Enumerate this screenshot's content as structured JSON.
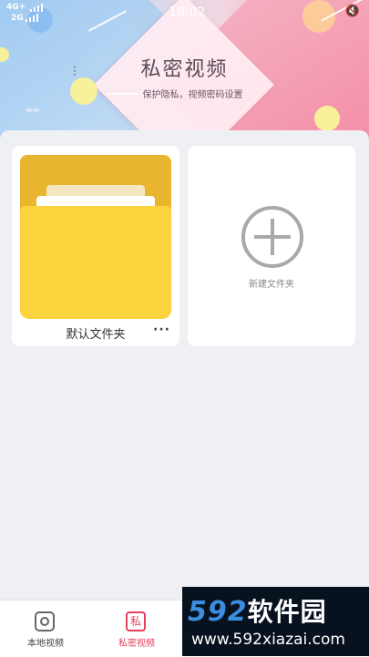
{
  "status_bar": {
    "network_top": "4G+",
    "network_bottom": "2G",
    "time": "18:02"
  },
  "header": {
    "title": "私密视频",
    "subtitle": "保护隐私，视频密码设置"
  },
  "folders": [
    {
      "label": "默认文件夹",
      "more_icon": "more-dots-icon"
    }
  ],
  "new_folder": {
    "label": "新建文件夹",
    "icon": "plus-circle-icon"
  },
  "tabbar": {
    "items": [
      {
        "label": "本地视频",
        "icon": "camera-icon",
        "active": false
      },
      {
        "label": "私密视频",
        "icon": "private-icon",
        "icon_text": "私",
        "active": true
      }
    ]
  },
  "watermark": {
    "logo_num": "592",
    "logo_text": "软件园",
    "url": "www.592xiazai.com"
  },
  "colors": {
    "accent": "#e6415f",
    "folder_yellow": "#fbd33c",
    "folder_back": "#e9b52f"
  }
}
